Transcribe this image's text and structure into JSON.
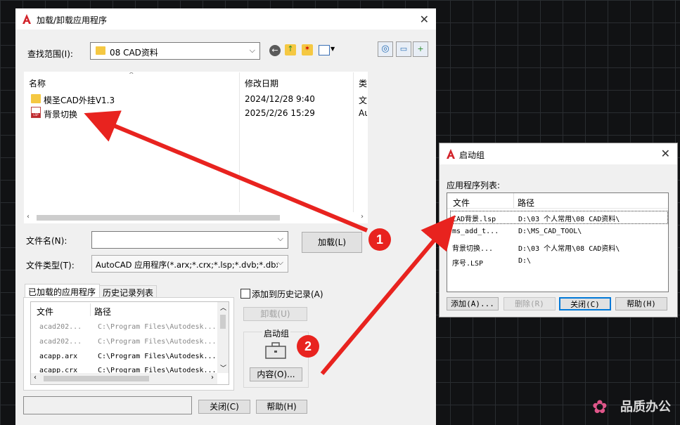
{
  "main_dialog": {
    "title": "加载/卸载应用程序",
    "lookin_label": "查找范围(I):",
    "lookin_value": "08 CAD资料",
    "columns": [
      "名称",
      "修改日期",
      "类"
    ],
    "files": [
      {
        "name": "模圣CAD外挂V1.3",
        "date": "2024/12/28 9:40",
        "type": "文"
      },
      {
        "name": "背景切换",
        "date": "2025/2/26 15:29",
        "type": "Au"
      }
    ],
    "filename_label": "文件名(N):",
    "filename_value": "",
    "filetype_label": "文件类型(T):",
    "filetype_value": "AutoCAD 应用程序(*.arx;*.crx;*.lsp;*.dvb;*.dbx",
    "load_button": "加载(L)",
    "tab_loaded": "已加载的应用程序",
    "tab_history": "历史记录列表",
    "add_history_label": "添加到历史记录(A)",
    "unload_button": "卸载(U)",
    "startup_group_label": "启动组",
    "contents_button": "内容(O)...",
    "loaded_columns": [
      "文件",
      "路径"
    ],
    "loaded_apps": [
      {
        "file": "acad202...",
        "path": "C:\\Program Files\\Autodesk..."
      },
      {
        "file": "acad202...",
        "path": "C:\\Program Files\\Autodesk..."
      },
      {
        "file": "acapp.arx",
        "path": "C:\\Program Files\\Autodesk..."
      },
      {
        "file": "acapp.crx",
        "path": "C:\\Program Files\\Autodesk..."
      }
    ],
    "close_button": "关闭(C)",
    "help_button": "帮助(H)"
  },
  "startup_dialog": {
    "title": "启动组",
    "list_label": "应用程序列表:",
    "columns": [
      "文件",
      "路径"
    ],
    "items": [
      {
        "file": "CAD背景.lsp",
        "path": "D:\\03 个人常用\\08 CAD资料\\"
      },
      {
        "file": "ms_add_t...",
        "path": "D:\\MS_CAD_TOOL\\"
      },
      {
        "file": "背景切换...",
        "path": "D:\\03 个人常用\\08 CAD资料\\"
      },
      {
        "file": "序号.LSP",
        "path": "D:\\"
      }
    ],
    "add_button": "添加(A)...",
    "delete_button": "删除(R)",
    "close_button": "关闭(C)",
    "help_button": "帮助(H)"
  },
  "annotations": {
    "badge1": "1",
    "badge2": "2"
  },
  "watermark": "品质办公",
  "colors": {
    "arrow": "#e8231f",
    "autocad_red": "#d2232a",
    "folder": "#f5c842"
  }
}
